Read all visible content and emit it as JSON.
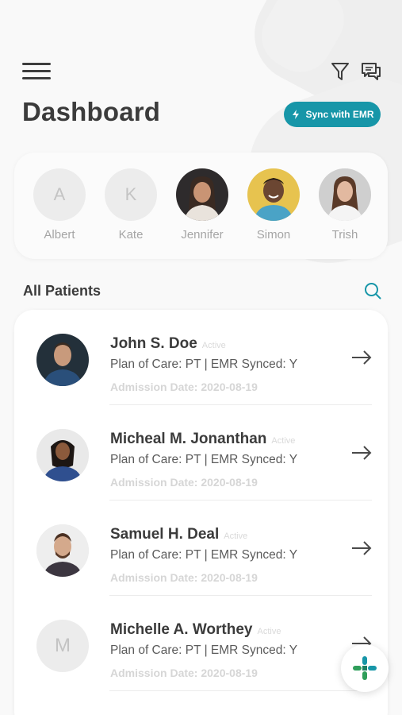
{
  "header": {
    "title": "Dashboard",
    "sync_label": "Sync with EMR",
    "accent_color": "#1796a8"
  },
  "recent": [
    {
      "initial": "A",
      "name": "Albert",
      "has_photo": false
    },
    {
      "initial": "K",
      "name": "Kate",
      "has_photo": false
    },
    {
      "initial": "",
      "name": "Jennifer",
      "has_photo": true
    },
    {
      "initial": "",
      "name": "Simon",
      "has_photo": true
    },
    {
      "initial": "",
      "name": "Trish",
      "has_photo": true
    }
  ],
  "patients_section": {
    "title": "All Patients"
  },
  "patients": [
    {
      "initial": "",
      "name": "John S. Doe",
      "status": "Active",
      "plan": "Plan of Care: PT | EMR Synced: Y",
      "admission": "Admission Date: 2020-08-19",
      "has_photo": true
    },
    {
      "initial": "",
      "name": "Micheal M. Jonanthan",
      "status": "Active",
      "plan": "Plan of Care: PT | EMR Synced: Y",
      "admission": "Admission Date: 2020-08-19",
      "has_photo": true
    },
    {
      "initial": "",
      "name": "Samuel H. Deal",
      "status": "Active",
      "plan": "Plan of Care: PT | EMR Synced: Y",
      "admission": "Admission Date: 2020-08-19",
      "has_photo": true
    },
    {
      "initial": "M",
      "name": "Michelle A. Worthey",
      "status": "Active",
      "plan": "Plan of Care: PT | EMR Synced: Y",
      "admission": "Admission Date: 2020-08-19",
      "has_photo": false
    }
  ],
  "icons": {
    "menu": "hamburger-menu-icon",
    "filter": "filter-icon",
    "chat": "chat-icon",
    "sync": "sync-icon",
    "search": "search-icon",
    "arrow": "arrow-right-icon",
    "fab": "medical-cross-icon"
  }
}
